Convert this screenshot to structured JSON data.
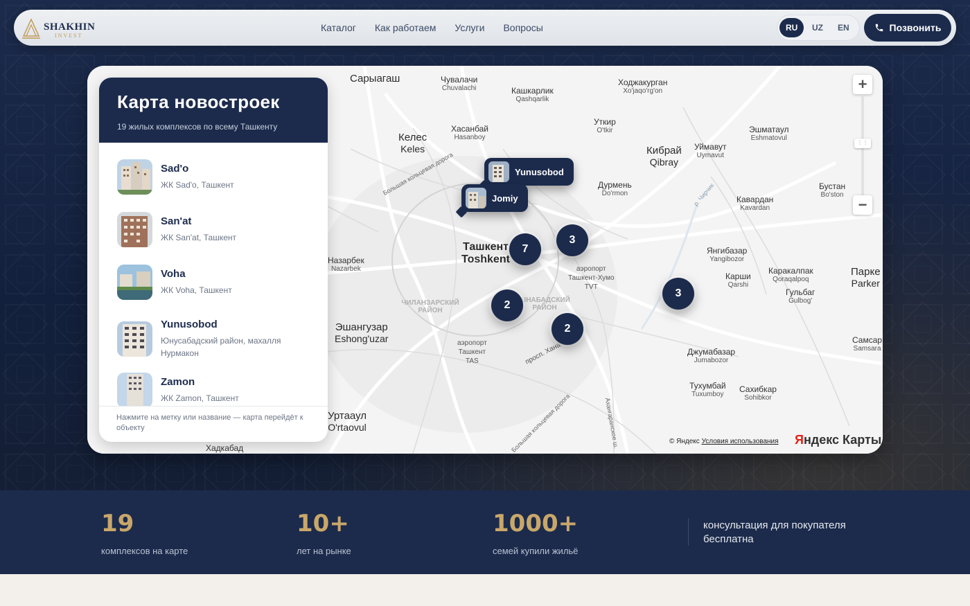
{
  "header": {
    "logo_text": "SHAKHIN",
    "logo_sub": "INVEST",
    "nav": [
      "Каталог",
      "Как работаем",
      "Услуги",
      "Вопросы"
    ],
    "languages": [
      "RU",
      "UZ",
      "EN"
    ],
    "active_language": "RU",
    "call_label": "Позвонить"
  },
  "panel": {
    "title": "Карта новостроек",
    "subtitle": "19 жилых комплексов по всему Ташкенту",
    "items": [
      {
        "name": "Sad'o",
        "desc": "ЖК Sad'o, Ташкент"
      },
      {
        "name": "San'at",
        "desc": "ЖК San'at, Ташкент"
      },
      {
        "name": "Voha",
        "desc": "ЖК Voha, Ташкент"
      },
      {
        "name": "Yunusobod",
        "desc": "Юнусабадский район, махалля Нурмакон"
      },
      {
        "name": "Zamon",
        "desc": "ЖК Zamon, Ташкент"
      }
    ],
    "footer": "Нажмите на метку или название — карта перейдёт к объекту"
  },
  "map": {
    "pins": [
      "Yunusobod",
      "Jomiy"
    ],
    "clusters": [
      "7",
      "3",
      "2",
      "2",
      "3"
    ],
    "places": [
      {
        "ru": "Сарыагаш",
        "uz": ""
      },
      {
        "ru": "Чувалачи",
        "uz": "Chuvalachi"
      },
      {
        "ru": "Кашкарлик",
        "uz": "Qashqarlik"
      },
      {
        "ru": "Ходжакурган",
        "uz": "Xo'jaqo'rg'on"
      },
      {
        "ru": "Хасанбай",
        "uz": "Hasanboy"
      },
      {
        "ru": "Келес",
        "uz": "Keles"
      },
      {
        "ru": "Уткир",
        "uz": "O'tkir"
      },
      {
        "ru": "Эшматаул",
        "uz": "Eshmatovul"
      },
      {
        "ru": "Кибрай",
        "uz": "Qibray"
      },
      {
        "ru": "Уймавут",
        "uz": "Uymavut"
      },
      {
        "ru": "Дурмень",
        "uz": "Do'rmon"
      },
      {
        "ru": "Бустан",
        "uz": "Bo'ston"
      },
      {
        "ru": "Кавардан",
        "uz": "Kavardan"
      },
      {
        "ru": "Ташкент",
        "uz": "Toshkent"
      },
      {
        "ru": "Назарбек",
        "uz": "Nazarbek"
      },
      {
        "ru": "аэропорт",
        "uz": "Ташкент-Хумо"
      },
      {
        "ru": "Янгибазар",
        "uz": "Yangibozor"
      },
      {
        "ru": "Каракалпак",
        "uz": "Qoraqalpoq"
      },
      {
        "ru": "Карши",
        "uz": "Qarshi"
      },
      {
        "ru": "Гульбаг",
        "uz": "Gulbog'"
      },
      {
        "ru": "Парке",
        "uz": "Parker"
      },
      {
        "ru": "Эшангузар",
        "uz": "Eshong'uzar"
      },
      {
        "ru": "аэропорт",
        "uz": "Ташкент"
      },
      {
        "ru": "Джумабазар",
        "uz": "Jumabozor"
      },
      {
        "ru": "Тухумбай",
        "uz": "Tuxumboy"
      },
      {
        "ru": "Сахибкар",
        "uz": "Sohibkor"
      },
      {
        "ru": "Самсар",
        "uz": "Samsara"
      },
      {
        "ru": "Уртааул",
        "uz": "O'rtaovul"
      },
      {
        "ru": "Хадкабад",
        "uz": ""
      }
    ],
    "airport_code_1": "TVT",
    "airport_code_2": "TAS",
    "district_1": "ЧИЛАНЗАРСКИЙ РАЙОН",
    "district_2": "ШНАБАДСКИЙ РАЙОН",
    "road_1": "Большая кольцевая дорога",
    "road_2": "просп. Хана",
    "road_3": "Ахангаранское ш.",
    "river": "р. Чирчик",
    "copyright_prefix": "© Яндекс",
    "copyright_link": "Условия использования",
    "brand_y": "Я",
    "brand_rest": "ндекс Карты"
  },
  "stats": [
    {
      "num": "19",
      "label": "комплексов на карте"
    },
    {
      "num": "10+",
      "label": "лет на рынке"
    },
    {
      "num": "1000+",
      "label": "семей купили жильё"
    }
  ],
  "stats_note": "консультация для покупателя бесплатна",
  "colors": {
    "navy": "#1c2b4c",
    "gold": "#c9a76a"
  }
}
